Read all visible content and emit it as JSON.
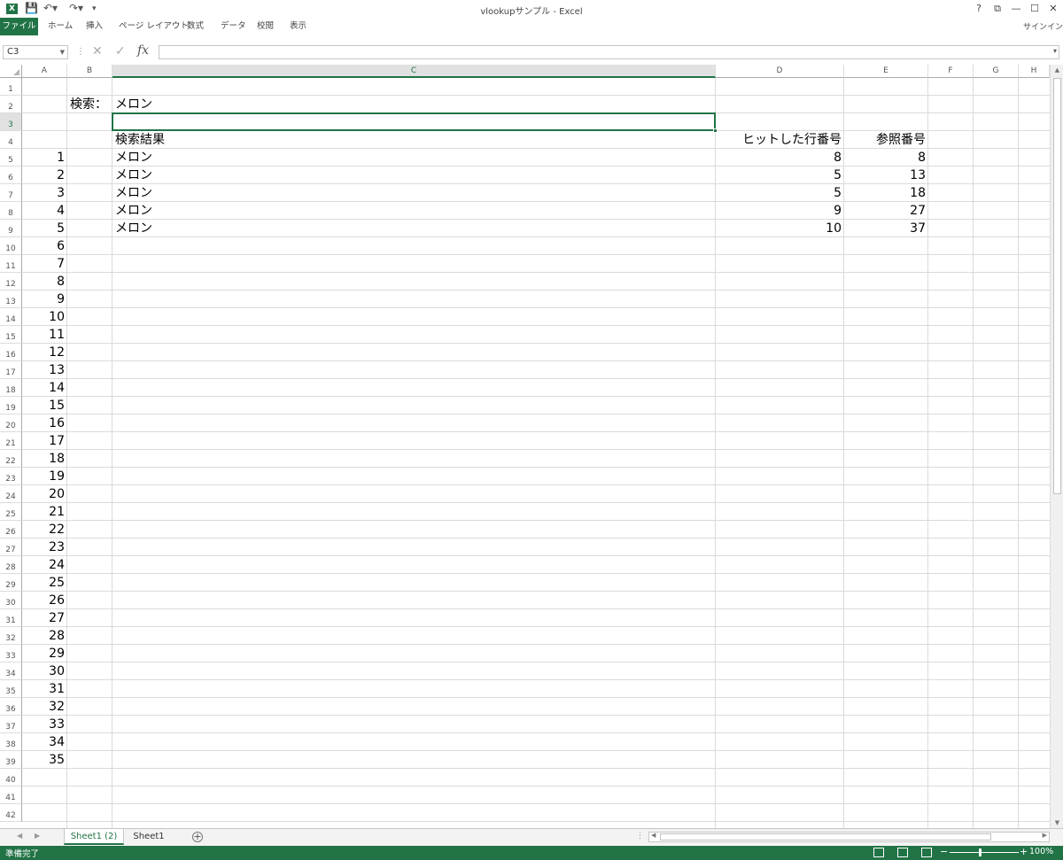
{
  "window": {
    "title": "vlookupサンプル - Excel",
    "app_icon": "X",
    "quick_access": [
      "save-icon",
      "undo-icon",
      "redo-icon",
      "customize-icon"
    ],
    "controls": [
      "?",
      "⧉",
      "—",
      "☐",
      "✕"
    ]
  },
  "ribbon": {
    "tabs": [
      "ファイル",
      "ホーム",
      "挿入",
      "ページ レイアウト",
      "数式",
      "データ",
      "校閲",
      "表示"
    ],
    "signin": "サインイン"
  },
  "formula_bar": {
    "name_box": "C3",
    "fx_label": "fx",
    "formula": ""
  },
  "grid": {
    "columns": [
      "A",
      "B",
      "C",
      "D",
      "E",
      "F",
      "G",
      "H"
    ],
    "active_column": "C",
    "rows": [
      "1",
      "2",
      "3",
      "4",
      "5",
      "6",
      "7",
      "8",
      "9",
      "10",
      "11",
      "12",
      "13",
      "14",
      "15",
      "16",
      "17",
      "18",
      "19",
      "20",
      "21",
      "22",
      "23",
      "24",
      "25",
      "26",
      "27",
      "28",
      "29",
      "30",
      "31",
      "32",
      "33",
      "34",
      "35",
      "36",
      "37",
      "38",
      "39",
      "40",
      "41",
      "42"
    ],
    "active_row": "3",
    "active_cell": "C3",
    "cells": {
      "B2": "検索：",
      "C2": "メロン",
      "C4": "検索結果",
      "D4": "ヒットした行番号",
      "E4": "参照番号",
      "A5": "1",
      "A6": "2",
      "A7": "3",
      "A8": "4",
      "A9": "5",
      "A10": "6",
      "A11": "7",
      "A12": "8",
      "A13": "9",
      "A14": "10",
      "A15": "11",
      "A16": "12",
      "A17": "13",
      "A18": "14",
      "A19": "15",
      "A20": "16",
      "A21": "17",
      "A22": "18",
      "A23": "19",
      "A24": "20",
      "A25": "21",
      "A26": "22",
      "A27": "23",
      "A28": "24",
      "A29": "25",
      "A30": "26",
      "A31": "27",
      "A32": "28",
      "A33": "29",
      "A34": "30",
      "A35": "31",
      "A36": "32",
      "A37": "33",
      "A38": "34",
      "A39": "35",
      "C5": "メロン",
      "C6": "メロン",
      "C7": "メロン",
      "C8": "メロン",
      "C9": "メロン",
      "D5": "8",
      "D6": "5",
      "D7": "5",
      "D8": "9",
      "D9": "10",
      "E5": "8",
      "E6": "13",
      "E7": "18",
      "E8": "27",
      "E9": "37"
    }
  },
  "sheets": {
    "tabs": [
      "Sheet1 (2)",
      "Sheet1"
    ],
    "active": "Sheet1 (2)",
    "add_label": "+"
  },
  "status_bar": {
    "ready": "準備完了",
    "zoom_minus": "−",
    "zoom_plus": "+",
    "zoom": "100%"
  },
  "colors": {
    "accent": "#217346",
    "gridline": "#dadada",
    "header_active_bg": "#e1e1e1"
  }
}
